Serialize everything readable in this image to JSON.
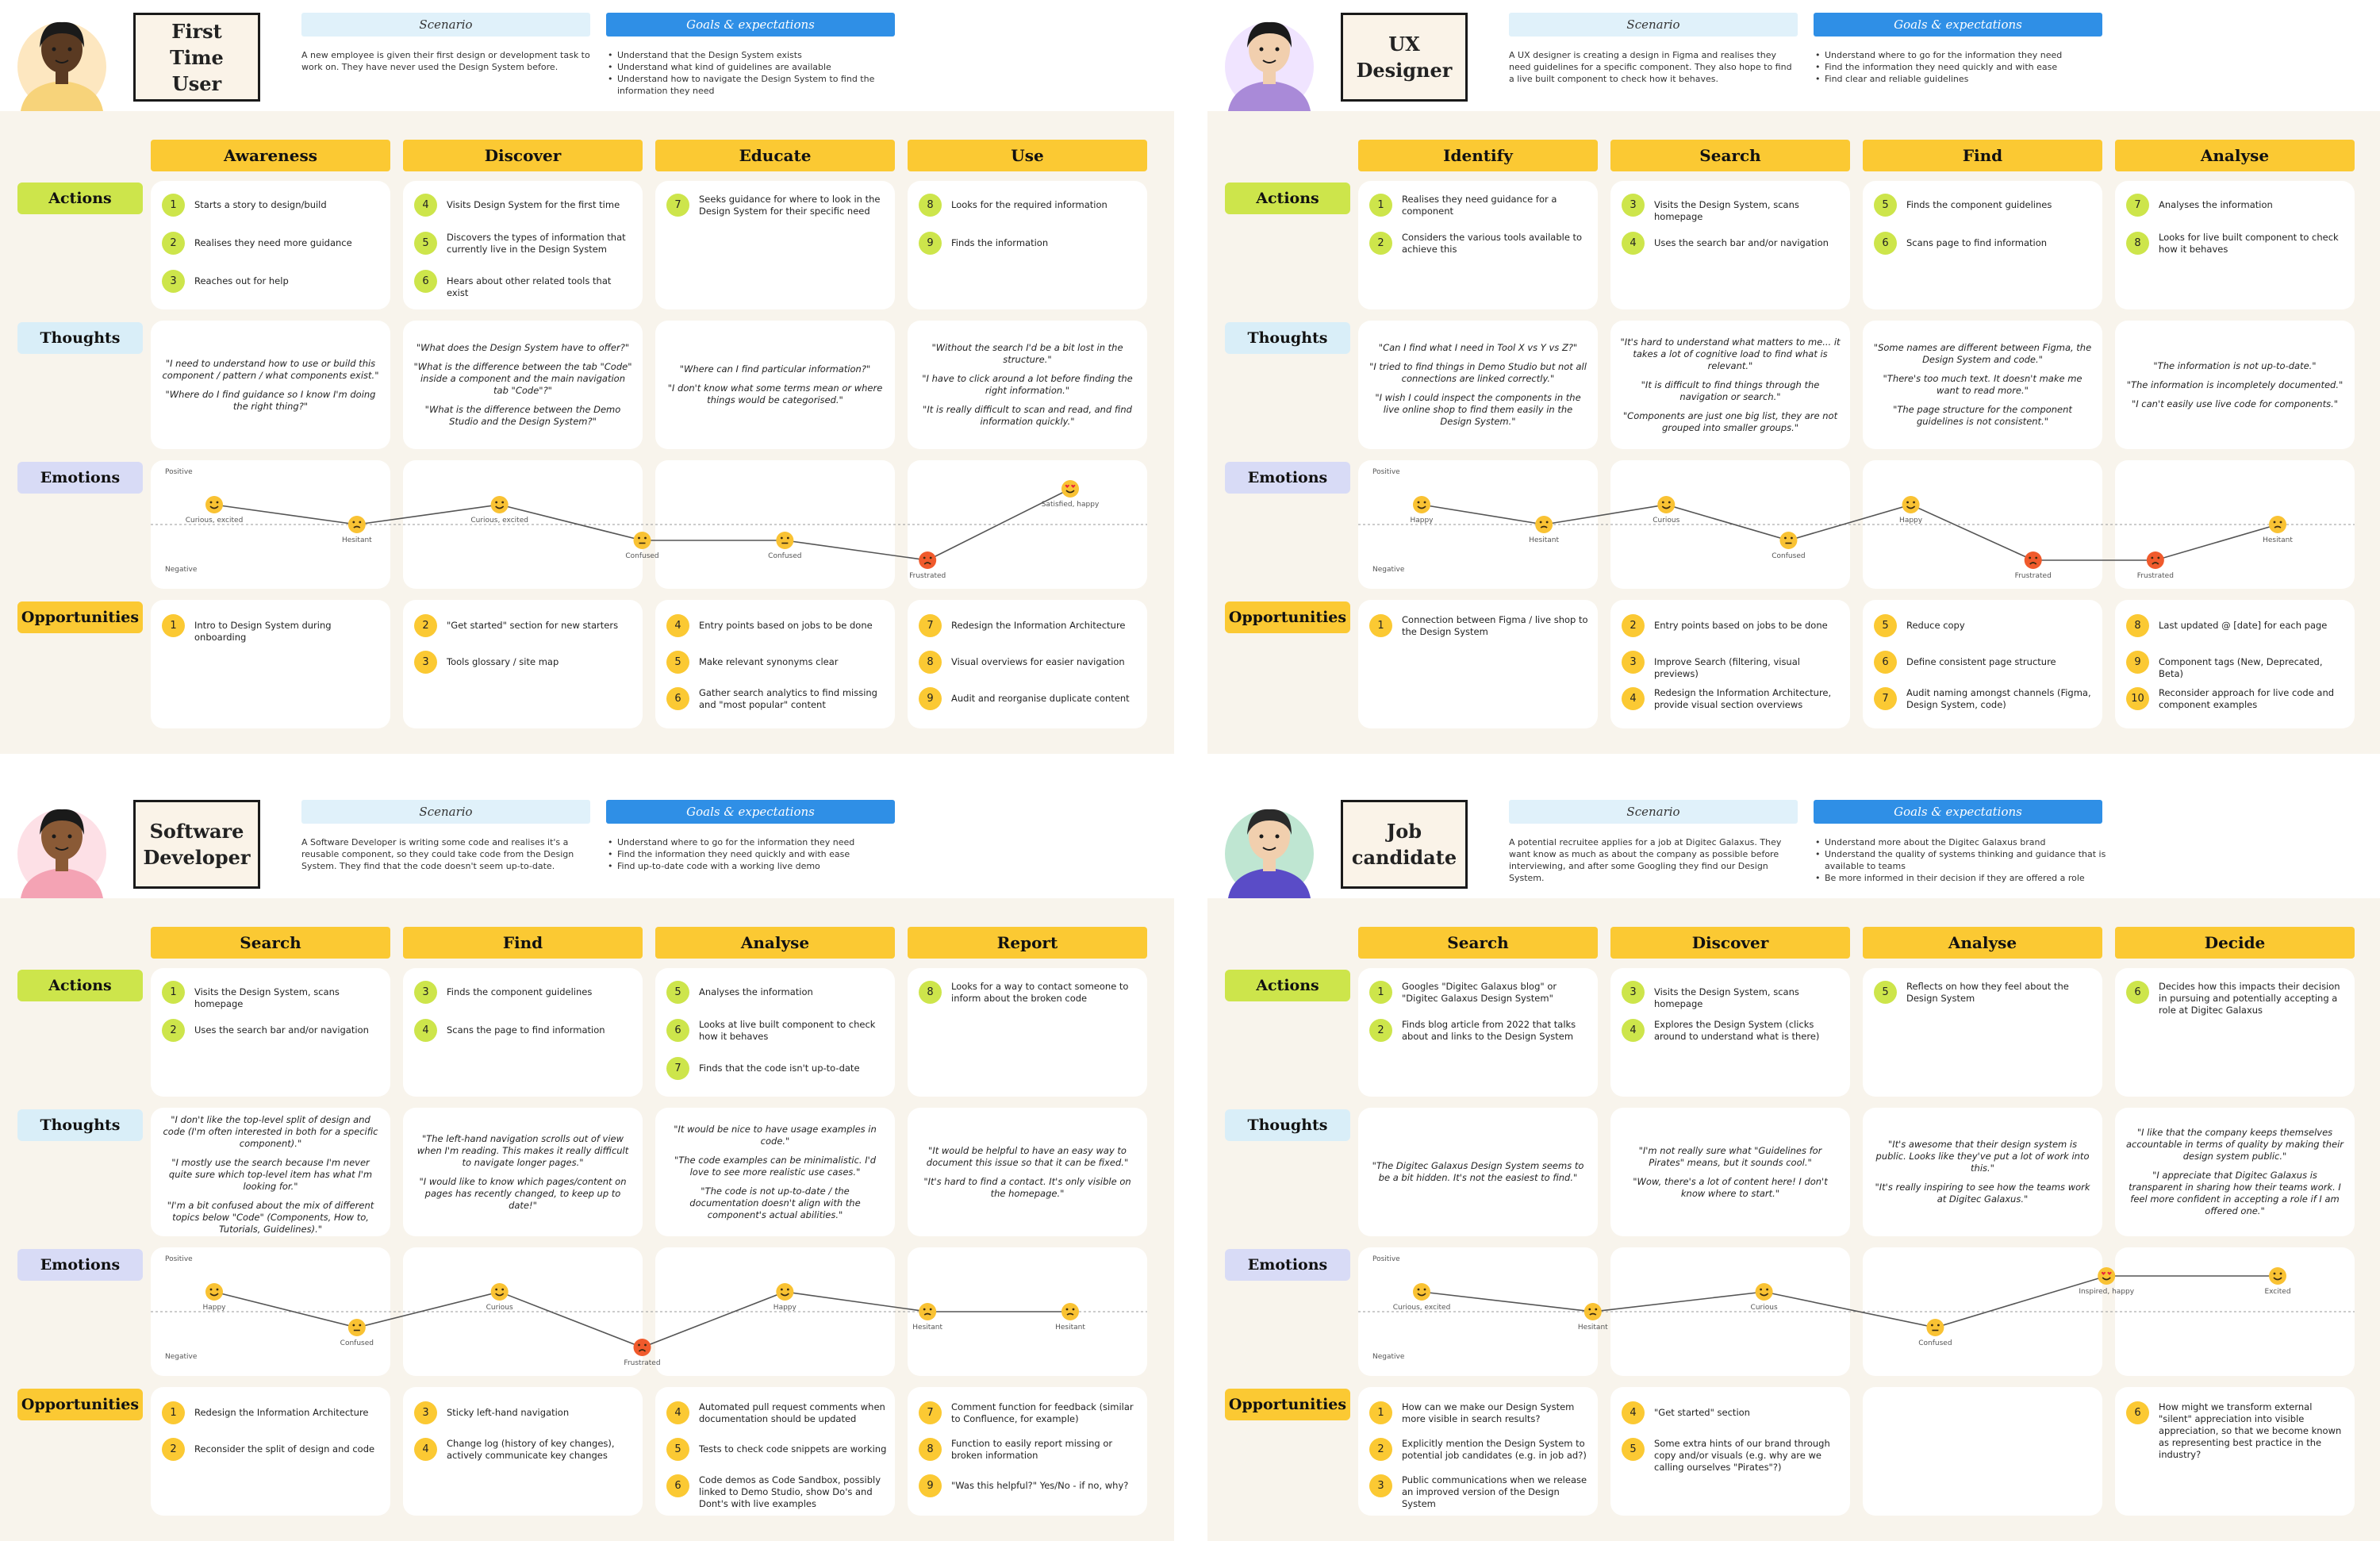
{
  "colors": {
    "actions": "#cde54b",
    "thoughts": "#d9eef8",
    "emotions": "#d8dbf6",
    "opportunities": "#fbc933",
    "phase": "#fbc933",
    "scenario": "#e0f1fa",
    "goals": "#2f8fe6",
    "background": "#f8f4ec"
  },
  "labels": {
    "scenario": "Scenario",
    "goals": "Goals & expectations",
    "actions": "Actions",
    "thoughts": "Thoughts",
    "emotions": "Emotions",
    "opportunities": "Opportunities",
    "positive": "Positive",
    "negative": "Negative"
  },
  "personas": [
    {
      "name": "First Time\nUser",
      "avatar": "woman-illustration",
      "scenario": "A new employee is given their first design or development task to work on. They have never used the Design System before.",
      "goals": [
        "Understand that the Design System exists",
        "Understand what kind of guidelines are available",
        "Understand how to navigate the Design System to find the information they need"
      ],
      "phases": [
        "Awareness",
        "Discover",
        "Educate",
        "Use"
      ],
      "actions": [
        [
          {
            "n": "1",
            "t": "Starts a story to design/build"
          },
          {
            "n": "2",
            "t": "Realises they need more guidance"
          },
          {
            "n": "3",
            "t": "Reaches out for help"
          }
        ],
        [
          {
            "n": "4",
            "t": "Visits Design System for the first time"
          },
          {
            "n": "5",
            "t": "Discovers the types of information that currently live in the Design System"
          },
          {
            "n": "6",
            "t": "Hears about other related tools that exist"
          }
        ],
        [
          {
            "n": "7",
            "t": "Seeks guidance for where to look in the Design System for their specific need"
          }
        ],
        [
          {
            "n": "8",
            "t": "Looks for the required information"
          },
          {
            "n": "9",
            "t": "Finds the information"
          }
        ]
      ],
      "thoughts": [
        [
          "\"I need to understand how to use or build this component / pattern / what components exist.\"",
          "\"Where do I find guidance so I know I'm doing the right thing?\""
        ],
        [
          "\"What does the Design System have to offer?\"",
          "\"What is the difference between the tab \"Code\" inside a component and the main navigation tab \"Code\"?\"",
          "\"What is the difference between the Demo Studio and the Design System?\""
        ],
        [
          "\"Where can I find particular information?\"",
          "\"I don't know what some terms mean or where things would be categorised.\""
        ],
        [
          "\"Without the search I'd be a bit lost in the structure.\"",
          "\"I have to click around a lot before finding the right information.\"",
          "\"It is really difficult to scan and read, and find information quickly.\""
        ]
      ],
      "emotions": [
        {
          "label": "Curious, excited",
          "level": 0.25,
          "face": "happy"
        },
        {
          "label": "Hesitant",
          "level": 0.0,
          "face": "hesitant"
        },
        {
          "label": "Curious, excited",
          "level": 0.25,
          "face": "happy"
        },
        {
          "label": "Confused",
          "level": -0.2,
          "face": "confused"
        },
        {
          "label": "Confused",
          "level": -0.2,
          "face": "confused"
        },
        {
          "label": "Frustrated",
          "level": -0.45,
          "face": "frustrated"
        },
        {
          "label": "Satisfied, happy",
          "level": 0.45,
          "face": "love"
        }
      ],
      "opportunities": [
        [
          {
            "n": "1",
            "t": "Intro to Design System during onboarding"
          }
        ],
        [
          {
            "n": "2",
            "t": "\"Get started\" section for new starters"
          },
          {
            "n": "3",
            "t": "Tools glossary / site map"
          }
        ],
        [
          {
            "n": "4",
            "t": "Entry points based on jobs to be done"
          },
          {
            "n": "5",
            "t": "Make relevant synonyms clear"
          },
          {
            "n": "6",
            "t": "Gather search analytics to find missing and \"most popular\" content"
          }
        ],
        [
          {
            "n": "7",
            "t": "Redesign the Information Architecture"
          },
          {
            "n": "8",
            "t": "Visual overviews for easier navigation"
          },
          {
            "n": "9",
            "t": "Audit and reorganise duplicate content"
          }
        ]
      ]
    },
    {
      "name": "UX\nDesigner",
      "avatar": "designer-illustration",
      "scenario": "A UX designer is creating a design in Figma and realises they need guidelines for a specific component. They also hope to find a live built component to check how it behaves.",
      "goals": [
        "Understand where to go for the information they need",
        "Find the information they need quickly and with ease",
        "Find clear and reliable guidelines"
      ],
      "phases": [
        "Identify",
        "Search",
        "Find",
        "Analyse"
      ],
      "actions": [
        [
          {
            "n": "1",
            "t": "Realises they need guidance for a component"
          },
          {
            "n": "2",
            "t": "Considers the various tools available to achieve this"
          }
        ],
        [
          {
            "n": "3",
            "t": "Visits the Design System, scans homepage"
          },
          {
            "n": "4",
            "t": "Uses the search bar and/or navigation"
          }
        ],
        [
          {
            "n": "5",
            "t": "Finds the component guidelines"
          },
          {
            "n": "6",
            "t": "Scans page to find information"
          }
        ],
        [
          {
            "n": "7",
            "t": "Analyses the information"
          },
          {
            "n": "8",
            "t": "Looks for live built component to check how it behaves"
          }
        ]
      ],
      "thoughts": [
        [
          "\"Can I find what I need in Tool X vs Y vs Z?\"",
          "\"I tried to find things in Demo Studio but not all connections are linked correctly.\"",
          "\"I wish I could inspect the components in the live online shop to find them easily in the Design System.\""
        ],
        [
          "\"It's hard to understand what matters to me... it takes a lot of cognitive load to find what is relevant.\"",
          "\"It is difficult to find things through the navigation or search.\"",
          "\"Components are just one big list, they are not grouped into smaller groups.\""
        ],
        [
          "\"Some names are different between Figma, the Design System and code.\"",
          "\"There's too much text. It doesn't make me want to read more.\"",
          "\"The page structure for the component guidelines is not consistent.\""
        ],
        [
          "\"The information is not up-to-date.\"",
          "\"The information is incompletely documented.\"",
          "\"I can't easily use live code for components.\""
        ]
      ],
      "emotions": [
        {
          "label": "Happy",
          "level": 0.25,
          "face": "happy"
        },
        {
          "label": "Hesitant",
          "level": 0.0,
          "face": "hesitant"
        },
        {
          "label": "Curious",
          "level": 0.25,
          "face": "happy"
        },
        {
          "label": "Confused",
          "level": -0.2,
          "face": "confused"
        },
        {
          "label": "Happy",
          "level": 0.25,
          "face": "happy"
        },
        {
          "label": "Frustrated",
          "level": -0.45,
          "face": "frustrated"
        },
        {
          "label": "Frustrated",
          "level": -0.45,
          "face": "frustrated"
        },
        {
          "label": "Hesitant",
          "level": 0.0,
          "face": "hesitant"
        }
      ],
      "opportunities": [
        [
          {
            "n": "1",
            "t": "Connection between Figma / live shop to the Design System"
          }
        ],
        [
          {
            "n": "2",
            "t": "Entry points based on jobs to be done"
          },
          {
            "n": "3",
            "t": "Improve Search (filtering, visual previews)"
          },
          {
            "n": "4",
            "t": "Redesign the Information Architecture, provide visual section overviews"
          }
        ],
        [
          {
            "n": "5",
            "t": "Reduce copy"
          },
          {
            "n": "6",
            "t": "Define consistent page structure"
          },
          {
            "n": "7",
            "t": "Audit naming amongst channels (Figma, Design System, code)"
          }
        ],
        [
          {
            "n": "8",
            "t": "Last updated @ [date] for each page"
          },
          {
            "n": "9",
            "t": "Component tags (New, Deprecated, Beta)"
          },
          {
            "n": "10",
            "t": "Reconsider approach for live code and component examples"
          }
        ]
      ]
    },
    {
      "name": "Software\nDeveloper",
      "avatar": "developer-illustration",
      "scenario": "A Software Developer is writing some code and realises it's a reusable component, so they could take code from the Design System. They find that the code doesn't seem up-to-date.",
      "goals": [
        "Understand where to go for the information they need",
        "Find the information they need quickly and with ease",
        "Find up-to-date code with a working live demo"
      ],
      "phases": [
        "Search",
        "Find",
        "Analyse",
        "Report"
      ],
      "actions": [
        [
          {
            "n": "1",
            "t": "Visits the Design System, scans homepage"
          },
          {
            "n": "2",
            "t": "Uses the search bar and/or navigation"
          }
        ],
        [
          {
            "n": "3",
            "t": "Finds the component guidelines"
          },
          {
            "n": "4",
            "t": "Scans the page to find information"
          }
        ],
        [
          {
            "n": "5",
            "t": "Analyses the information"
          },
          {
            "n": "6",
            "t": "Looks at live built component to check how it behaves"
          },
          {
            "n": "7",
            "t": "Finds that the code isn't up-to-date"
          }
        ],
        [
          {
            "n": "8",
            "t": "Looks for a way to contact someone to inform about the broken code"
          }
        ]
      ],
      "thoughts": [
        [
          "\"I don't like the top-level split of design and code (I'm often interested in both for a specific component).\"",
          "\"I mostly use the search because I'm never quite sure which top-level item has what I'm looking for.\"",
          "\"I'm a bit confused about the mix of different topics below \"Code\" (Components, How to, Tutorials, Guidelines).\""
        ],
        [
          "\"The left-hand navigation scrolls out of view when I'm reading. This makes it really difficult to navigate longer pages.\"",
          "\"I would like to know which pages/content on pages has recently changed, to keep up to date!\""
        ],
        [
          "\"It would be nice to have usage examples in code.\"",
          "\"The code examples can be minimalistic. I'd love to see more realistic use cases.\"",
          "\"The code is not up-to-date / the documentation doesn't align with the component's actual abilities.\""
        ],
        [
          "\"It would be helpful to have an easy way to document this issue so that it can be fixed.\"",
          "\"It's hard to find a contact. It's only visible on the homepage.\""
        ]
      ],
      "emotions": [
        {
          "label": "Happy",
          "level": 0.25,
          "face": "happy"
        },
        {
          "label": "Confused",
          "level": -0.2,
          "face": "confused"
        },
        {
          "label": "Curious",
          "level": 0.25,
          "face": "happy"
        },
        {
          "label": "Frustrated",
          "level": -0.45,
          "face": "frustrated"
        },
        {
          "label": "Happy",
          "level": 0.25,
          "face": "happy"
        },
        {
          "label": "Hesitant",
          "level": 0.0,
          "face": "hesitant"
        },
        {
          "label": "Hesitant",
          "level": 0.0,
          "face": "hesitant"
        }
      ],
      "opportunities": [
        [
          {
            "n": "1",
            "t": "Redesign the Information Architecture"
          },
          {
            "n": "2",
            "t": "Reconsider the split of design and code"
          }
        ],
        [
          {
            "n": "3",
            "t": "Sticky left-hand navigation"
          },
          {
            "n": "4",
            "t": "Change log (history of key changes), actively communicate key changes"
          }
        ],
        [
          {
            "n": "4",
            "t": "Automated pull request comments when documentation should be updated"
          },
          {
            "n": "5",
            "t": "Tests to check code snippets are working"
          },
          {
            "n": "6",
            "t": "Code demos as Code Sandbox, possibly linked to Demo Studio, show Do's and Dont's with live examples"
          }
        ],
        [
          {
            "n": "7",
            "t": "Comment function for feedback (similar to Confluence, for example)"
          },
          {
            "n": "8",
            "t": "Function to easily report missing or broken information"
          },
          {
            "n": "9",
            "t": "\"Was this helpful?\" Yes/No - if no, why?"
          }
        ]
      ]
    },
    {
      "name": "Job\ncandidate",
      "avatar": "candidate-illustration",
      "scenario": "A potential recruitee applies for a job at Digitec Galaxus. They want know as much as about the company as possible before interviewing, and after some Googling they find our Design System.",
      "goals": [
        "Understand more about the Digitec Galaxus brand",
        "Understand the quality of systems thinking and guidance that is available to teams",
        "Be more informed in their decision if they are offered a role"
      ],
      "phases": [
        "Search",
        "Discover",
        "Analyse",
        "Decide"
      ],
      "actions": [
        [
          {
            "n": "1",
            "t": "Googles \"Digitec Galaxus blog\" or \"Digitec Galaxus Design System\""
          },
          {
            "n": "2",
            "t": "Finds blog article from 2022 that talks about and links to the Design System"
          }
        ],
        [
          {
            "n": "3",
            "t": "Visits the Design System, scans homepage"
          },
          {
            "n": "4",
            "t": "Explores the Design System (clicks around to understand what is there)"
          }
        ],
        [
          {
            "n": "5",
            "t": "Reflects on how they feel about the Design System"
          }
        ],
        [
          {
            "n": "6",
            "t": "Decides how this impacts their decision in pursuing and potentially accepting a role at Digitec Galaxus"
          }
        ]
      ],
      "thoughts": [
        [
          "\"The Digitec Galaxus Design System seems to be a bit hidden. It's not the easiest to find.\""
        ],
        [
          "\"I'm not really sure what \"Guidelines for Pirates\" means, but it sounds cool.\"",
          "\"Wow, there's a lot of content here! I don't know where to start.\""
        ],
        [
          "\"It's awesome that their design system is public. Looks like they've put a lot of work into this.\"",
          "\"It's really inspiring to see how the teams work at Digitec Galaxus.\""
        ],
        [
          "\"I like that the company keeps themselves accountable in terms of quality by making their design system public.\"",
          "\"I appreciate that Digitec Galaxus is transparent in sharing how their teams work. I feel more confident in accepting a role if I am offered one.\""
        ]
      ],
      "emotions": [
        {
          "label": "Curious, excited",
          "level": 0.25,
          "face": "happy"
        },
        {
          "label": "Hesitant",
          "level": 0.0,
          "face": "hesitant"
        },
        {
          "label": "Curious",
          "level": 0.25,
          "face": "happy"
        },
        {
          "label": "Confused",
          "level": -0.2,
          "face": "confused"
        },
        {
          "label": "Inspired, happy",
          "level": 0.45,
          "face": "love"
        },
        {
          "label": "Excited",
          "level": 0.45,
          "face": "happy"
        }
      ],
      "opportunities": [
        [
          {
            "n": "1",
            "t": "How can we make our Design System more visible in search results?"
          },
          {
            "n": "2",
            "t": "Explicitly mention the Design System to potential job candidates (e.g. in job ad?)"
          },
          {
            "n": "3",
            "t": "Public communications when we release an improved version of the Design System"
          }
        ],
        [
          {
            "n": "4",
            "t": "\"Get started\" section"
          },
          {
            "n": "5",
            "t": "Some extra hints of our brand through copy and/or visuals (e.g. why are we calling ourselves \"Pirates\"?)"
          }
        ],
        [],
        [
          {
            "n": "6",
            "t": "How might we transform external \"silent\" appreciation into visible appreciation, so that we become known as representing best practice in the industry?"
          }
        ]
      ]
    }
  ]
}
